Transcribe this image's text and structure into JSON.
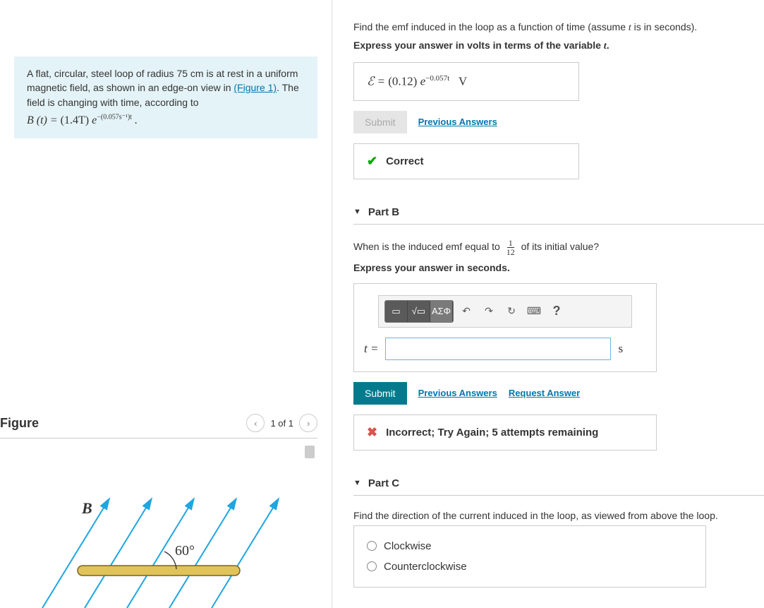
{
  "intro": {
    "text_prefix": "A flat, circular, steel loop of radius 75 cm is at rest in a uniform magnetic field, as shown in an edge-on view in ",
    "figure_link": "(Figure 1)",
    "text_suffix": ". The field is changing with time, according to",
    "equation_lhs": "B (t) = ",
    "equation_coeff": "(1.4T)",
    "equation_e": " e",
    "equation_exp": "−(0.057s⁻¹)t",
    "equation_end": " ."
  },
  "figure": {
    "title": "Figure",
    "pager_label": "1 of 1",
    "b_label": "B⃗",
    "angle_label": "60°"
  },
  "partA": {
    "prompt": "Find the emf induced in the loop as a function of time (assume ",
    "prompt_var": "t",
    "prompt_suffix": " is in seconds).",
    "sub": "Express your answer in volts in terms of the variable ",
    "sub_var": "t",
    "sub_end": ".",
    "answer_prefix": "ℰ = ",
    "answer_coeff": "(0.12)",
    "answer_e": " e",
    "answer_exp": "−0.057t",
    "answer_unit": "V",
    "submit": "Submit",
    "prev": "Previous Answers",
    "feedback": "Correct"
  },
  "partB": {
    "header": "Part B",
    "prompt_prefix": "When is the induced emf equal to ",
    "frac_num": "1",
    "frac_den": "12",
    "prompt_suffix": " of its initial value?",
    "sub": "Express your answer in seconds.",
    "toolbar_greek": "ΑΣΦ",
    "var_label": "t =",
    "unit": "s",
    "submit": "Submit",
    "prev": "Previous Answers",
    "req": "Request Answer",
    "feedback": "Incorrect; Try Again; 5 attempts remaining",
    "help": "?"
  },
  "partC": {
    "header": "Part C",
    "prompt": "Find the direction of the current induced in the loop, as viewed from above the loop.",
    "opt1": "Clockwise",
    "opt2": "Counterclockwise"
  }
}
